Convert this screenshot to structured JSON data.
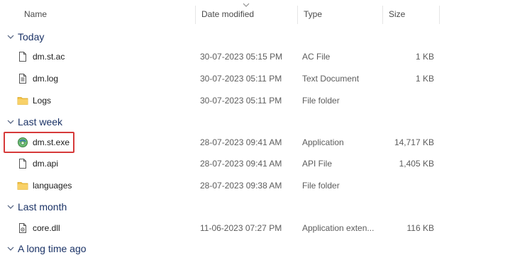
{
  "columns": {
    "name": "Name",
    "date": "Date modified",
    "type": "Type",
    "size": "Size"
  },
  "groups": [
    {
      "label": "Today",
      "files": [
        {
          "name": "dm.st.ac",
          "date": "30-07-2023 05:15 PM",
          "type": "AC File",
          "size": "1 KB",
          "icon": "document-icon"
        },
        {
          "name": "dm.log",
          "date": "30-07-2023 05:11 PM",
          "type": "Text Document",
          "size": "1 KB",
          "icon": "text-document-icon"
        },
        {
          "name": "Logs",
          "date": "30-07-2023 05:11 PM",
          "type": "File folder",
          "size": "",
          "icon": "folder-icon"
        }
      ]
    },
    {
      "label": "Last week",
      "files": [
        {
          "name": "dm.st.exe",
          "date": "28-07-2023 09:41 AM",
          "type": "Application",
          "size": "14,717 KB",
          "icon": "application-icon",
          "highlighted": true
        },
        {
          "name": "dm.api",
          "date": "28-07-2023 09:41 AM",
          "type": "API File",
          "size": "1,405 KB",
          "icon": "document-icon"
        },
        {
          "name": "languages",
          "date": "28-07-2023 09:38 AM",
          "type": "File folder",
          "size": "",
          "icon": "folder-icon"
        }
      ]
    },
    {
      "label": "Last month",
      "files": [
        {
          "name": "core.dll",
          "date": "11-06-2023 07:27 PM",
          "type": "Application exten...",
          "size": "116 KB",
          "icon": "dll-icon"
        }
      ]
    },
    {
      "label": "A long time ago",
      "files": []
    }
  ],
  "colors": {
    "highlight_border": "#d63a3a",
    "group_header": "#1a3266",
    "folder": "#f3c34a"
  }
}
